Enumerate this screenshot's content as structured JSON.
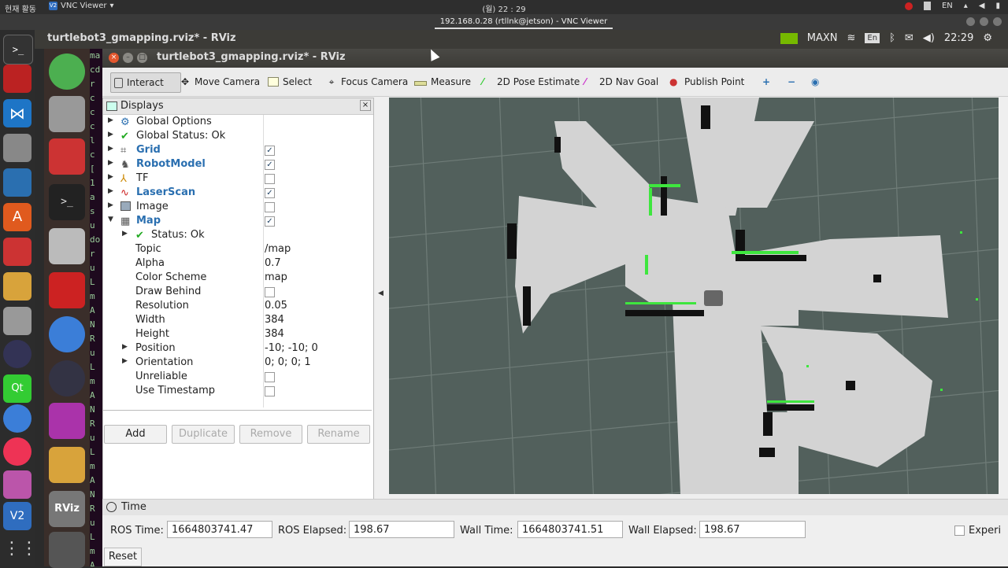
{
  "host": {
    "left_label": "현재 활동",
    "vnc_menu": "VNC Viewer",
    "clock": "(월) 22 : 29",
    "lang": "EN",
    "vnc_window_title": "192.168.0.28 (rtllnk@jetson) - VNC Viewer"
  },
  "panel": {
    "title": "turtlebot3_gmapping.rviz* - RViz",
    "gpu_mode": "MAXN",
    "input_lang": "En",
    "time": "22:29"
  },
  "rviz": {
    "window_title": "turtlebot3_gmapping.rviz* - RViz",
    "toolbar": [
      {
        "label": "Interact",
        "icon": "interact-icon"
      },
      {
        "label": "Move Camera",
        "icon": "move-camera-icon"
      },
      {
        "label": "Select",
        "icon": "select-icon"
      },
      {
        "label": "Focus Camera",
        "icon": "focus-camera-icon"
      },
      {
        "label": "Measure",
        "icon": "measure-icon"
      },
      {
        "label": "2D Pose Estimate",
        "icon": "pose-estimate-icon"
      },
      {
        "label": "2D Nav Goal",
        "icon": "nav-goal-icon"
      },
      {
        "label": "Publish Point",
        "icon": "publish-point-icon"
      }
    ],
    "displays": {
      "title": "Displays",
      "items": [
        {
          "name": "Global Options"
        },
        {
          "name": "Global Status: Ok"
        },
        {
          "name": "Grid",
          "checked": "✓"
        },
        {
          "name": "RobotModel",
          "checked": "✓"
        },
        {
          "name": "TF",
          "checked": ""
        },
        {
          "name": "LaserScan",
          "checked": "✓"
        },
        {
          "name": "Image",
          "checked": ""
        },
        {
          "name": "Map",
          "checked": "✓"
        },
        {
          "name": "Status: Ok"
        },
        {
          "name": "Topic",
          "value": "/map"
        },
        {
          "name": "Alpha",
          "value": "0.7"
        },
        {
          "name": "Color Scheme",
          "value": "map"
        },
        {
          "name": "Draw Behind",
          "checked": ""
        },
        {
          "name": "Resolution",
          "value": "0.05"
        },
        {
          "name": "Width",
          "value": "384"
        },
        {
          "name": "Height",
          "value": "384"
        },
        {
          "name": "Position",
          "value": "-10; -10; 0"
        },
        {
          "name": "Orientation",
          "value": "0; 0; 0; 1"
        },
        {
          "name": "Unreliable",
          "checked": ""
        },
        {
          "name": "Use Timestamp",
          "checked": ""
        }
      ],
      "buttons": {
        "add": "Add",
        "duplicate": "Duplicate",
        "remove": "Remove",
        "rename": "Rename"
      }
    },
    "time": {
      "title": "Time",
      "ros_time_label": "ROS Time:",
      "ros_time": "1664803741.47",
      "ros_elapsed_label": "ROS Elapsed:",
      "ros_elapsed": "198.67",
      "wall_time_label": "Wall Time:",
      "wall_time": "1664803741.51",
      "wall_elapsed_label": "Wall Elapsed:",
      "wall_elapsed": "198.67",
      "experimental": "Experi",
      "reset": "Reset"
    }
  },
  "terminal_text": "ma\ncd\nr\nc\nc\nc\nl\nc\n[\n1\na\ns\nu\ndo\nr\nu\nL\nm\nA\nN\nR\nu\nL\nm\nA\nN\nR\nu\nL\nm\nA\nN\nR\nu\nL\nm\nA\nN"
}
